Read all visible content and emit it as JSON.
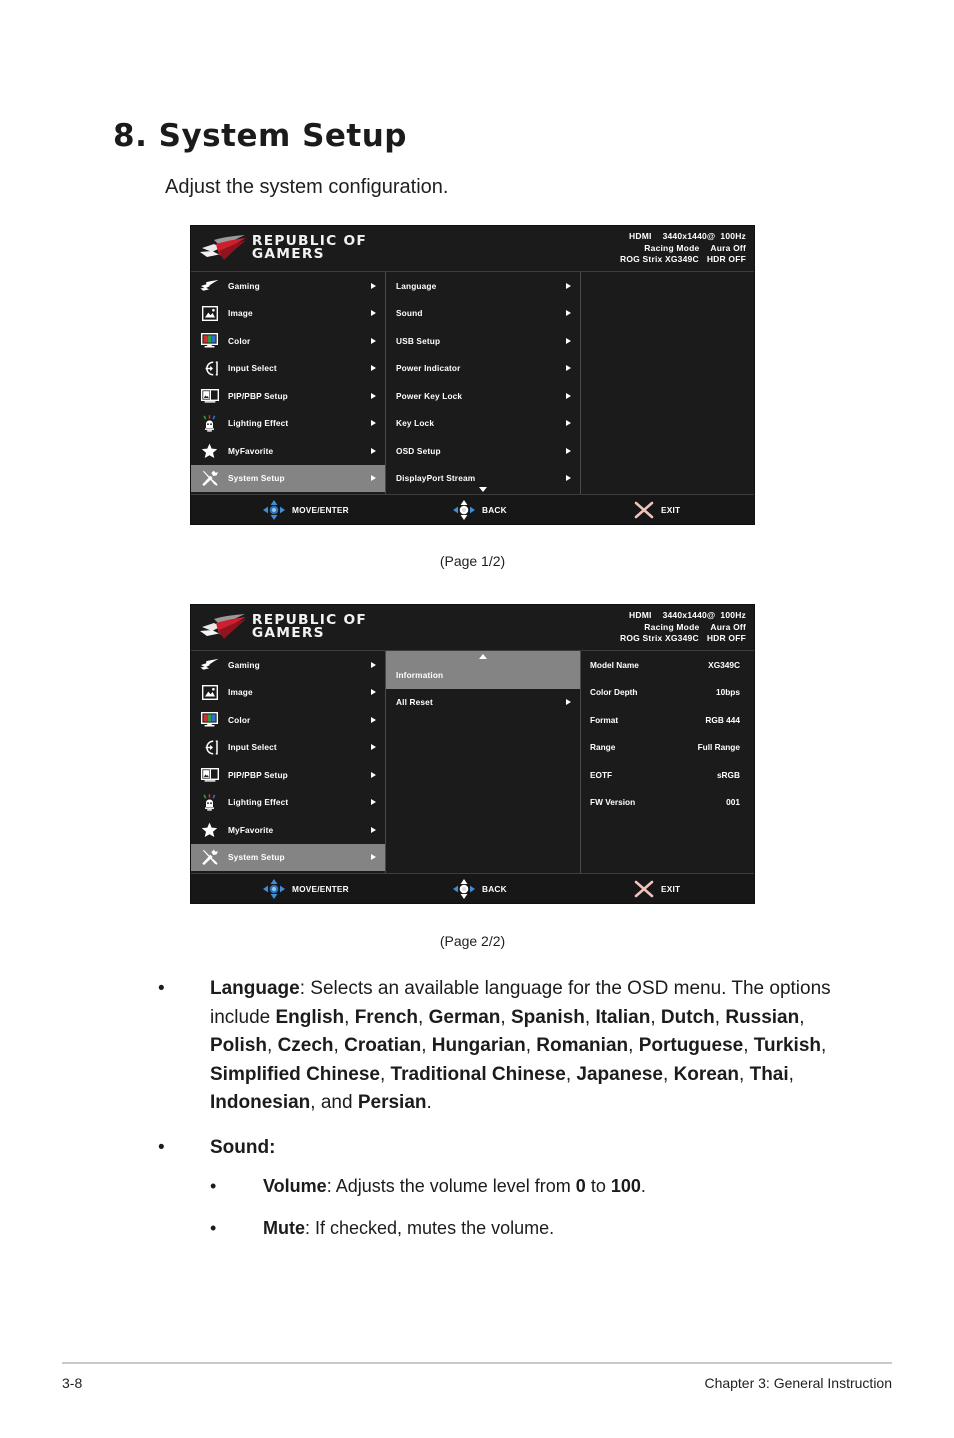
{
  "heading": "8. System Setup",
  "lead": "Adjust the system configuration.",
  "osd": {
    "logo_line1": "REPUBLIC OF",
    "logo_line2": "GAMERS",
    "status": {
      "input": "HDMI",
      "resolution": "3440x1440@",
      "refresh": "100Hz",
      "mode": "Racing Mode",
      "aura": "Aura Off",
      "model": "ROG Strix XG349C",
      "hdr": "HDR OFF"
    },
    "main_menu": [
      {
        "label": "Gaming",
        "icon": "rog-eye-icon"
      },
      {
        "label": "Image",
        "icon": "image-icon"
      },
      {
        "label": "Color",
        "icon": "color-monitor-icon"
      },
      {
        "label": "Input Select",
        "icon": "input-select-icon"
      },
      {
        "label": "PIP/PBP Setup",
        "icon": "pip-pbp-icon"
      },
      {
        "label": "Lighting Effect",
        "icon": "lighting-effect-icon"
      },
      {
        "label": "MyFavorite",
        "icon": "star-icon"
      },
      {
        "label": "System Setup",
        "icon": "wrench-screwdriver-icon"
      }
    ],
    "submenu_page1": [
      {
        "label": "Language"
      },
      {
        "label": "Sound"
      },
      {
        "label": "USB Setup"
      },
      {
        "label": "Power Indicator"
      },
      {
        "label": "Power Key Lock"
      },
      {
        "label": "Key Lock"
      },
      {
        "label": "OSD Setup"
      },
      {
        "label": "DisplayPort Stream"
      }
    ],
    "submenu_page2": [
      {
        "label": "Information"
      },
      {
        "label": "All Reset"
      }
    ],
    "information": [
      {
        "key": "Model Name",
        "value": "XG349C"
      },
      {
        "key": "Color Depth",
        "value": "10bps"
      },
      {
        "key": "Format",
        "value": "RGB 444"
      },
      {
        "key": "Range",
        "value": "Full Range"
      },
      {
        "key": "EOTF",
        "value": "sRGB"
      },
      {
        "key": "FW Version",
        "value": "001"
      }
    ],
    "footer": {
      "move": "MOVE/ENTER",
      "back": "BACK",
      "exit": "EXIT"
    },
    "caption_page1": "(Page 1/2)",
    "caption_page2": "(Page 2/2)",
    "colors": {
      "panel_bg": "#1b1b1b",
      "selected_bg": "#848484",
      "accent_blue": "#3f8fd8",
      "exit_x": "#f2c3bd",
      "rog_red": "#cf1f2e"
    }
  },
  "body": {
    "language": {
      "term": "Language",
      "text_1": ": Selects an available language for the OSD menu. The options include ",
      "options": [
        "English",
        "French",
        "German",
        "Spanish",
        "Italian",
        "Dutch",
        "Russian",
        "Polish",
        "Czech",
        "Croatian",
        "Hungarian",
        "Romanian",
        "Portuguese",
        "Turkish",
        "Simplified Chinese",
        "Traditional Chinese",
        "Japanese",
        "Korean",
        "Thai",
        "Indonesian"
      ],
      "conjunction": ", and ",
      "last_option": "Persian",
      "end": "."
    },
    "sound": {
      "term": "Sound:",
      "volume": {
        "term": "Volume",
        "text_1": ": Adjusts the volume level from ",
        "min": "0",
        "text_2": " to ",
        "max": "100",
        "end": "."
      },
      "mute": {
        "term": "Mute",
        "text": ": If checked, mutes the volume."
      }
    },
    "bullet_glyph": "•"
  },
  "page_footer": {
    "page_number": "3-8",
    "chapter": "Chapter 3: General Instruction"
  }
}
